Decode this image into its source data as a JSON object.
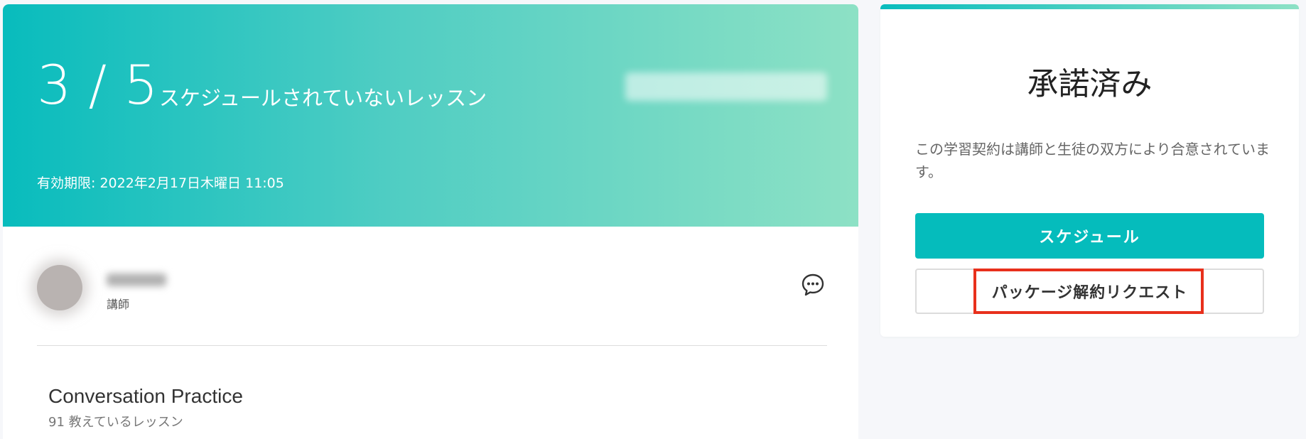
{
  "hero": {
    "count": "3 / 5",
    "count_label": "スケジュールされていないレッスン",
    "expiry": "有効期限: 2022年2月17日木曜日 11:05"
  },
  "teacher": {
    "role": "講師"
  },
  "course": {
    "title": "Conversation Practice",
    "subtitle": "91 教えているレッスン"
  },
  "status_panel": {
    "title": "承諾済み",
    "description": "この学習契約は講師と生徒の双方により合意されています。",
    "schedule_button": "スケジュール",
    "cancel_request_button": "パッケージ解約リクエスト"
  },
  "colors": {
    "accent": "#05bcbc",
    "gradient_end": "#8de1c5",
    "highlight": "#e8301c"
  },
  "icons": {
    "chat": "chat-bubble-icon"
  }
}
